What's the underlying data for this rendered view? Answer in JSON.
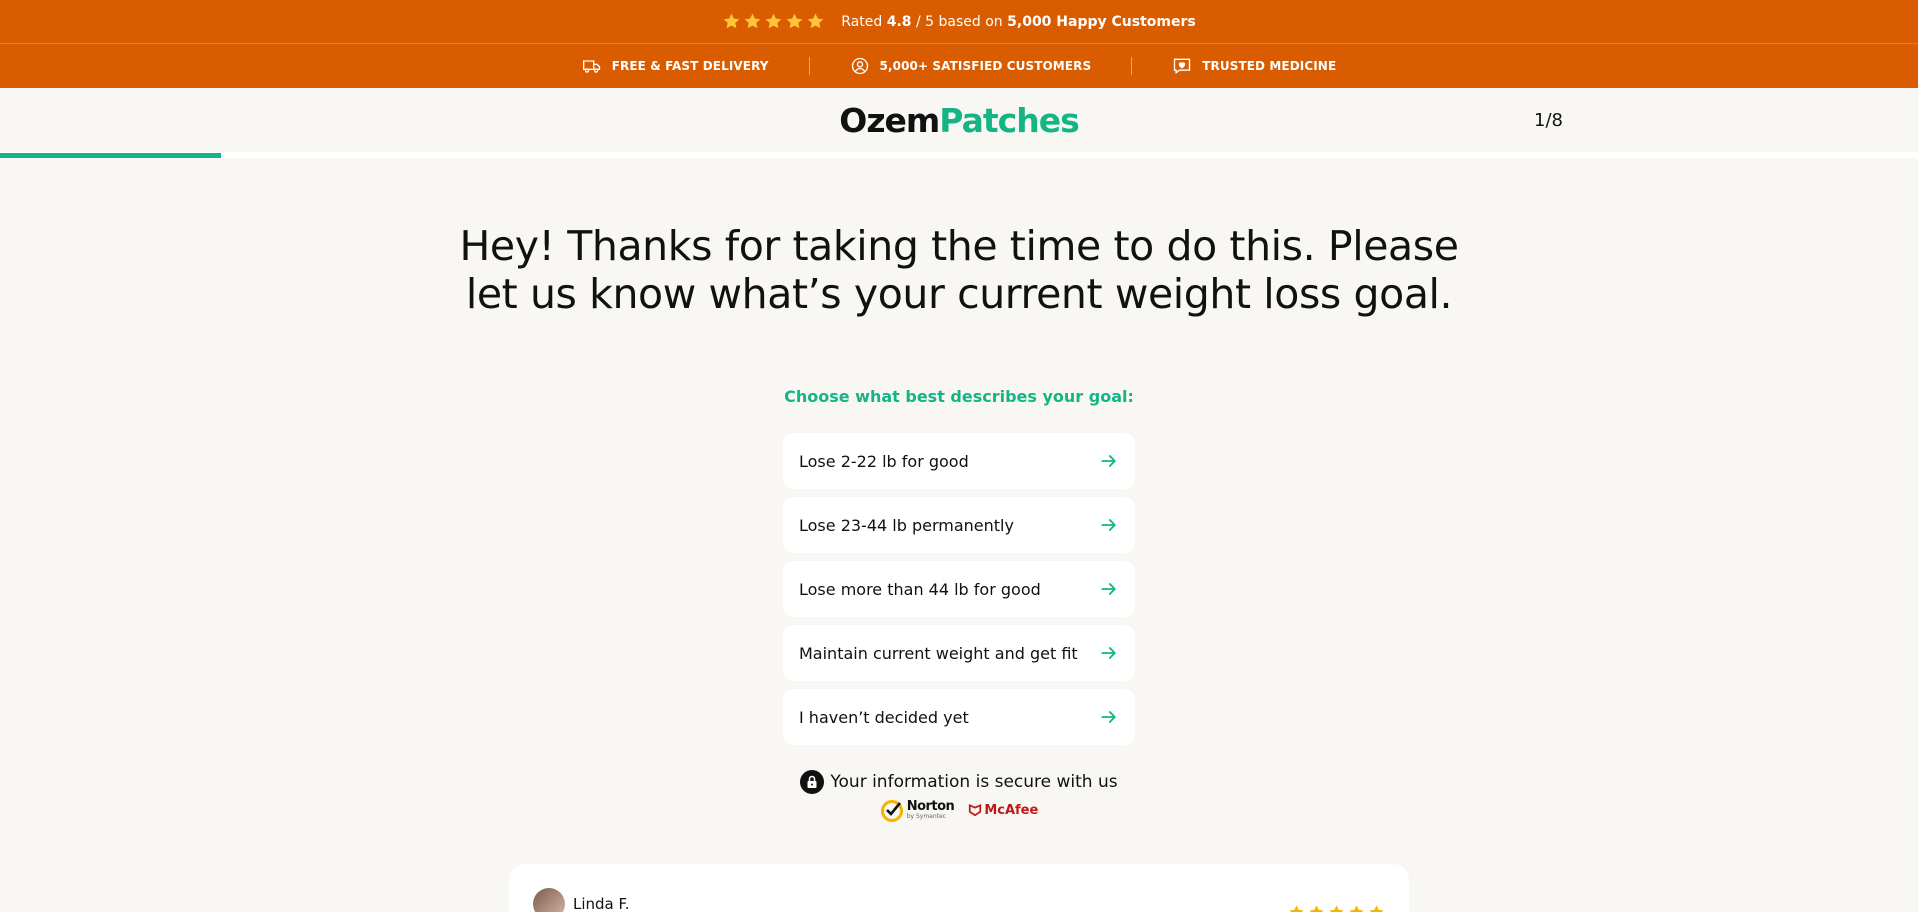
{
  "topbar": {
    "rated_prefix": "Rated",
    "rating": "4.8",
    "rating_scale": "/ 5 based on",
    "customers": "5,000 Happy Customers",
    "star_count": 5
  },
  "trustbar": {
    "items": [
      {
        "label": "FREE & FAST DELIVERY",
        "icon": "truck-icon"
      },
      {
        "label": "5,000+ SATISFIED CUSTOMERS",
        "icon": "user-circle-icon"
      },
      {
        "label": "TRUSTED MEDICINE",
        "icon": "heart-message-icon"
      }
    ]
  },
  "header": {
    "logo_part1": "Ozem",
    "logo_part2": "Patches",
    "step": "1/8",
    "progress": 0.115
  },
  "main": {
    "heading": "Hey! Thanks for taking the time to do this. Please let us know what’s your current weight loss goal.",
    "subheading": "Choose what best describes your goal:",
    "options": [
      "Lose 2-22 lb for good",
      "Lose 23-44 lb permanently",
      "Lose more than 44 lb for good",
      "Maintain current weight and get fit",
      "I haven’t decided yet"
    ]
  },
  "security": {
    "text": "Your information is secure with us",
    "norton": "Norton",
    "norton_sub": "by Symantec",
    "mcafee": "McAfee"
  },
  "review": {
    "name": "Linda F.",
    "stars": 5
  },
  "colors": {
    "brand_orange": "#d95d00",
    "accent_green": "#13b585",
    "star_yellow": "#ffc53a",
    "background": "#f8f7f3"
  }
}
